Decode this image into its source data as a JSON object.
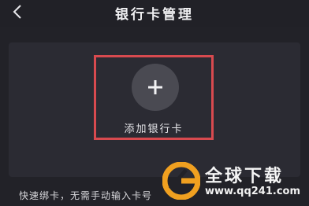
{
  "header": {
    "title": "银行卡管理",
    "back_icon": "chevron-left-icon"
  },
  "card_panel": {
    "add_button": {
      "icon": "plus-icon",
      "label": "添加银行卡"
    }
  },
  "tip": {
    "text": "快速绑卡，无需手动输入卡号"
  },
  "watermark": {
    "title": "全球下载",
    "url": "www.qq241.com",
    "logo_icon": "g-logo-icon",
    "accent_color": "#f0a020"
  },
  "colors": {
    "background": "#222228",
    "panel": "#2b2b33",
    "highlight_border": "#d84a4f",
    "plus_circle": "#4a4a52"
  }
}
